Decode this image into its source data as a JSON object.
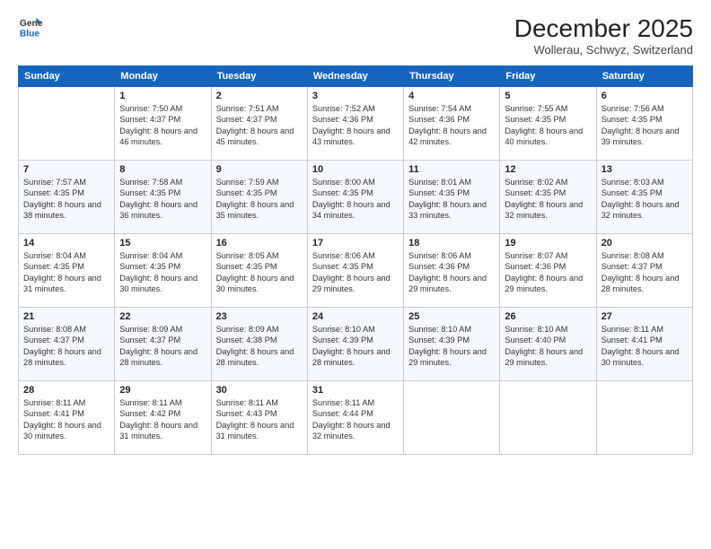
{
  "header": {
    "logo_line1": "General",
    "logo_line2": "Blue",
    "month": "December 2025",
    "location": "Wollerau, Schwyz, Switzerland"
  },
  "days": [
    "Sunday",
    "Monday",
    "Tuesday",
    "Wednesday",
    "Thursday",
    "Friday",
    "Saturday"
  ],
  "weeks": [
    [
      {
        "date": "",
        "sunrise": "",
        "sunset": "",
        "daylight": ""
      },
      {
        "date": "1",
        "sunrise": "Sunrise: 7:50 AM",
        "sunset": "Sunset: 4:37 PM",
        "daylight": "Daylight: 8 hours and 46 minutes."
      },
      {
        "date": "2",
        "sunrise": "Sunrise: 7:51 AM",
        "sunset": "Sunset: 4:37 PM",
        "daylight": "Daylight: 8 hours and 45 minutes."
      },
      {
        "date": "3",
        "sunrise": "Sunrise: 7:52 AM",
        "sunset": "Sunset: 4:36 PM",
        "daylight": "Daylight: 8 hours and 43 minutes."
      },
      {
        "date": "4",
        "sunrise": "Sunrise: 7:54 AM",
        "sunset": "Sunset: 4:36 PM",
        "daylight": "Daylight: 8 hours and 42 minutes."
      },
      {
        "date": "5",
        "sunrise": "Sunrise: 7:55 AM",
        "sunset": "Sunset: 4:35 PM",
        "daylight": "Daylight: 8 hours and 40 minutes."
      },
      {
        "date": "6",
        "sunrise": "Sunrise: 7:56 AM",
        "sunset": "Sunset: 4:35 PM",
        "daylight": "Daylight: 8 hours and 39 minutes."
      }
    ],
    [
      {
        "date": "7",
        "sunrise": "Sunrise: 7:57 AM",
        "sunset": "Sunset: 4:35 PM",
        "daylight": "Daylight: 8 hours and 38 minutes."
      },
      {
        "date": "8",
        "sunrise": "Sunrise: 7:58 AM",
        "sunset": "Sunset: 4:35 PM",
        "daylight": "Daylight: 8 hours and 36 minutes."
      },
      {
        "date": "9",
        "sunrise": "Sunrise: 7:59 AM",
        "sunset": "Sunset: 4:35 PM",
        "daylight": "Daylight: 8 hours and 35 minutes."
      },
      {
        "date": "10",
        "sunrise": "Sunrise: 8:00 AM",
        "sunset": "Sunset: 4:35 PM",
        "daylight": "Daylight: 8 hours and 34 minutes."
      },
      {
        "date": "11",
        "sunrise": "Sunrise: 8:01 AM",
        "sunset": "Sunset: 4:35 PM",
        "daylight": "Daylight: 8 hours and 33 minutes."
      },
      {
        "date": "12",
        "sunrise": "Sunrise: 8:02 AM",
        "sunset": "Sunset: 4:35 PM",
        "daylight": "Daylight: 8 hours and 32 minutes."
      },
      {
        "date": "13",
        "sunrise": "Sunrise: 8:03 AM",
        "sunset": "Sunset: 4:35 PM",
        "daylight": "Daylight: 8 hours and 32 minutes."
      }
    ],
    [
      {
        "date": "14",
        "sunrise": "Sunrise: 8:04 AM",
        "sunset": "Sunset: 4:35 PM",
        "daylight": "Daylight: 8 hours and 31 minutes."
      },
      {
        "date": "15",
        "sunrise": "Sunrise: 8:04 AM",
        "sunset": "Sunset: 4:35 PM",
        "daylight": "Daylight: 8 hours and 30 minutes."
      },
      {
        "date": "16",
        "sunrise": "Sunrise: 8:05 AM",
        "sunset": "Sunset: 4:35 PM",
        "daylight": "Daylight: 8 hours and 30 minutes."
      },
      {
        "date": "17",
        "sunrise": "Sunrise: 8:06 AM",
        "sunset": "Sunset: 4:35 PM",
        "daylight": "Daylight: 8 hours and 29 minutes."
      },
      {
        "date": "18",
        "sunrise": "Sunrise: 8:06 AM",
        "sunset": "Sunset: 4:36 PM",
        "daylight": "Daylight: 8 hours and 29 minutes."
      },
      {
        "date": "19",
        "sunrise": "Sunrise: 8:07 AM",
        "sunset": "Sunset: 4:36 PM",
        "daylight": "Daylight: 8 hours and 29 minutes."
      },
      {
        "date": "20",
        "sunrise": "Sunrise: 8:08 AM",
        "sunset": "Sunset: 4:37 PM",
        "daylight": "Daylight: 8 hours and 28 minutes."
      }
    ],
    [
      {
        "date": "21",
        "sunrise": "Sunrise: 8:08 AM",
        "sunset": "Sunset: 4:37 PM",
        "daylight": "Daylight: 8 hours and 28 minutes."
      },
      {
        "date": "22",
        "sunrise": "Sunrise: 8:09 AM",
        "sunset": "Sunset: 4:37 PM",
        "daylight": "Daylight: 8 hours and 28 minutes."
      },
      {
        "date": "23",
        "sunrise": "Sunrise: 8:09 AM",
        "sunset": "Sunset: 4:38 PM",
        "daylight": "Daylight: 8 hours and 28 minutes."
      },
      {
        "date": "24",
        "sunrise": "Sunrise: 8:10 AM",
        "sunset": "Sunset: 4:39 PM",
        "daylight": "Daylight: 8 hours and 28 minutes."
      },
      {
        "date": "25",
        "sunrise": "Sunrise: 8:10 AM",
        "sunset": "Sunset: 4:39 PM",
        "daylight": "Daylight: 8 hours and 29 minutes."
      },
      {
        "date": "26",
        "sunrise": "Sunrise: 8:10 AM",
        "sunset": "Sunset: 4:40 PM",
        "daylight": "Daylight: 8 hours and 29 minutes."
      },
      {
        "date": "27",
        "sunrise": "Sunrise: 8:11 AM",
        "sunset": "Sunset: 4:41 PM",
        "daylight": "Daylight: 8 hours and 30 minutes."
      }
    ],
    [
      {
        "date": "28",
        "sunrise": "Sunrise: 8:11 AM",
        "sunset": "Sunset: 4:41 PM",
        "daylight": "Daylight: 8 hours and 30 minutes."
      },
      {
        "date": "29",
        "sunrise": "Sunrise: 8:11 AM",
        "sunset": "Sunset: 4:42 PM",
        "daylight": "Daylight: 8 hours and 31 minutes."
      },
      {
        "date": "30",
        "sunrise": "Sunrise: 8:11 AM",
        "sunset": "Sunset: 4:43 PM",
        "daylight": "Daylight: 8 hours and 31 minutes."
      },
      {
        "date": "31",
        "sunrise": "Sunrise: 8:11 AM",
        "sunset": "Sunset: 4:44 PM",
        "daylight": "Daylight: 8 hours and 32 minutes."
      },
      {
        "date": "",
        "sunrise": "",
        "sunset": "",
        "daylight": ""
      },
      {
        "date": "",
        "sunrise": "",
        "sunset": "",
        "daylight": ""
      },
      {
        "date": "",
        "sunrise": "",
        "sunset": "",
        "daylight": ""
      }
    ]
  ]
}
